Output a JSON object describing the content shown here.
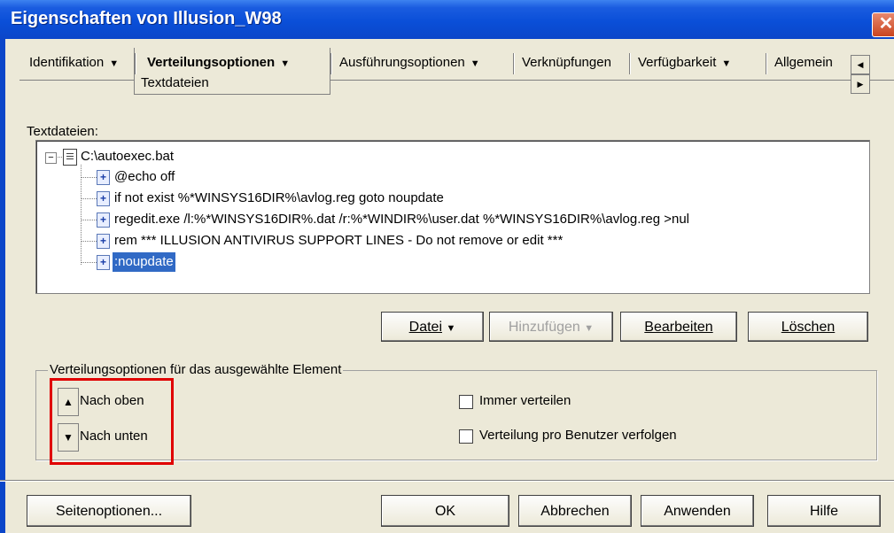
{
  "window": {
    "title": "Eigenschaften von Illusion_W98",
    "close_glyph": "✕"
  },
  "tabs": [
    {
      "label": "Identifikation",
      "has_menu": true
    },
    {
      "label": "Verteilungsoptionen",
      "has_menu": true,
      "active": true
    },
    {
      "label": "Ausführungsoptionen",
      "has_menu": true
    },
    {
      "label": "Verknüpfungen",
      "has_menu": false
    },
    {
      "label": "Verfügbarkeit",
      "has_menu": true
    },
    {
      "label": "Allgemein",
      "has_menu": false
    }
  ],
  "active_subtab": "Textdateien",
  "tree": {
    "label": "Textdateien:",
    "root": "C:\\autoexec.bat",
    "lines": [
      "@echo off",
      "if not exist %*WINSYS16DIR%\\avlog.reg goto noupdate",
      "regedit.exe /l:%*WINSYS16DIR%.dat /r:%*WINDIR%\\user.dat %*WINSYS16DIR%\\avlog.reg >nul",
      "rem *** ILLUSION ANTIVIRUS SUPPORT LINES - Do not remove or edit ***",
      ":noupdate"
    ],
    "selected_index": 4
  },
  "action_buttons": {
    "datei": "Datei",
    "hinzufuegen": "Hinzufügen",
    "bearbeiten": "Bearbeiten",
    "loeschen": "Löschen"
  },
  "group": {
    "title": "Verteilungsoptionen für das ausgewählte Element",
    "move_up": "Nach oben",
    "move_down": "Nach unten",
    "always_distribute": {
      "label": "Immer verteilen",
      "checked": false
    },
    "track_per_user": {
      "label": "Verteilung pro Benutzer verfolgen",
      "checked": false
    }
  },
  "footer": {
    "page_options": "Seitenoptionen...",
    "ok": "OK",
    "cancel": "Abbrechen",
    "apply": "Anwenden",
    "help": "Hilfe"
  },
  "colors": {
    "selection": "#316ac5",
    "highlight_box": "#e00000",
    "titlebar": "#0b46c9"
  }
}
